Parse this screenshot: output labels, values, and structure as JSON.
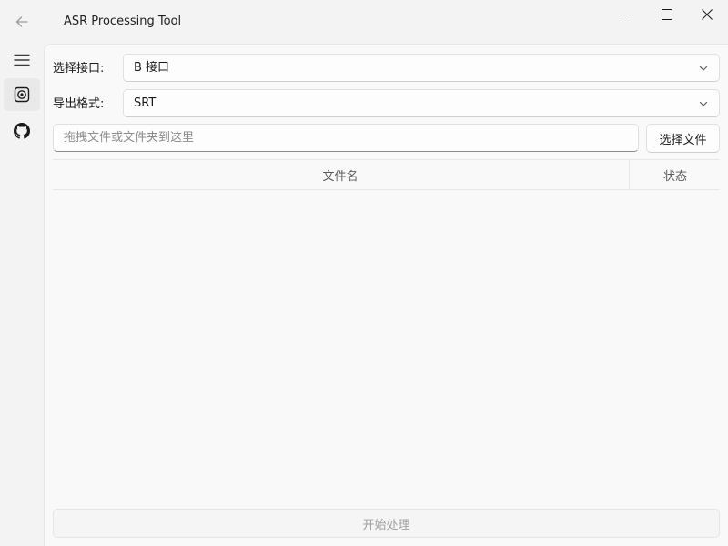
{
  "window": {
    "title": "ASR Processing Tool"
  },
  "sidebar": {
    "items": [
      {
        "name": "menu",
        "icon": "hamburger-menu-icon"
      },
      {
        "name": "asr",
        "icon": "record-icon",
        "selected": true
      },
      {
        "name": "github",
        "icon": "github-icon"
      }
    ],
    "accent": "#009faa"
  },
  "form": {
    "interface_label": "选择接口:",
    "interface_value": "B 接口",
    "format_label": "导出格式:",
    "format_value": "SRT"
  },
  "file_input": {
    "placeholder": "拖拽文件或文件夹到这里",
    "value": "",
    "select_button": "选择文件"
  },
  "table": {
    "columns": [
      "文件名",
      "状态"
    ],
    "rows": []
  },
  "actions": {
    "start_label": "开始处理",
    "start_enabled": false
  }
}
